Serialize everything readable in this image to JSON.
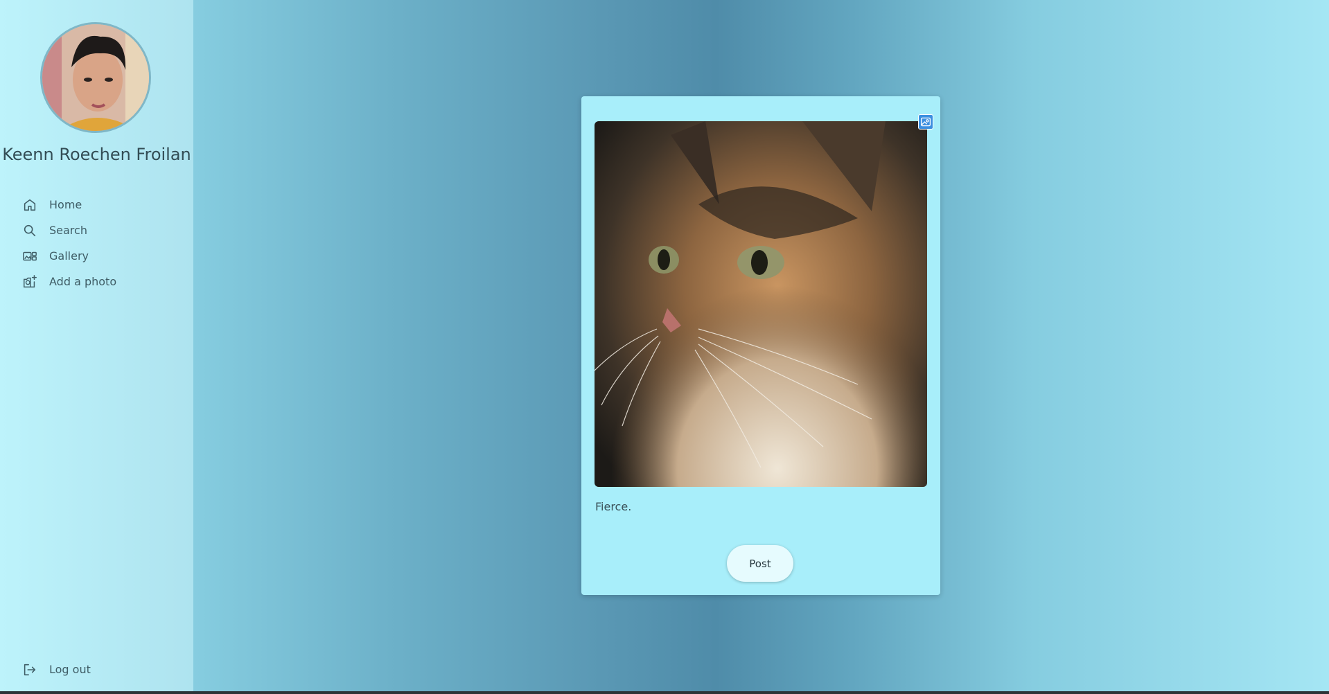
{
  "profile": {
    "name": "Keenn Roechen Froilan"
  },
  "nav": {
    "items": [
      {
        "label": "Home",
        "icon": "home-icon"
      },
      {
        "label": "Search",
        "icon": "search-icon"
      },
      {
        "label": "Gallery",
        "icon": "gallery-icon"
      },
      {
        "label": "Add a photo",
        "icon": "add-photo-icon"
      }
    ],
    "logout": {
      "label": "Log out",
      "icon": "logout-icon"
    }
  },
  "post": {
    "caption": "Fierce.",
    "button_label": "Post"
  },
  "colors": {
    "sidebar": "#bdf3fb",
    "card": "#a8eefa",
    "button": "#e6fbfe",
    "badge": "#3c8fe0"
  }
}
